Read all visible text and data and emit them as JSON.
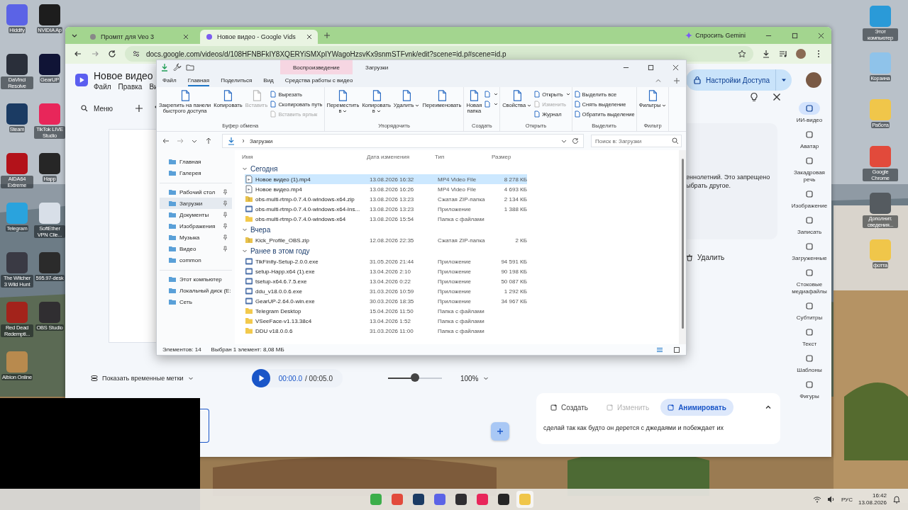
{
  "desktop": {
    "left_icons": [
      {
        "label": "Hiddify",
        "color": "#5b63e6"
      },
      {
        "label": "NVIDIA Ap",
        "color": "#1d1d1d"
      },
      {
        "label": "DaVinci Resolve",
        "color": "#2a2f3a"
      },
      {
        "label": "GearUP",
        "color": "#101436"
      },
      {
        "label": "Steam",
        "color": "#1b3b63"
      },
      {
        "label": "TikTok LIVE Studio",
        "color": "#e8265a"
      },
      {
        "label": "AIDA64 Extreme",
        "color": "#b3121a"
      },
      {
        "label": "Happ",
        "color": "#262626"
      },
      {
        "label": "Telegram",
        "color": "#2aa3dd"
      },
      {
        "label": "SoftEther VPN Clie...",
        "color": "#d8dfe8"
      },
      {
        "label": "The Witcher 3 Wild Hunt",
        "color": "#3a3a44"
      },
      {
        "label": "595.97-desk",
        "color": "#2b2b2b"
      },
      {
        "label": "Red Dead Redempti...",
        "color": "#a3231b"
      },
      {
        "label": "OBS Studio",
        "color": "#302e31"
      },
      {
        "label": "Albion Online",
        "color": "#b88a4e"
      }
    ],
    "right_icons": [
      {
        "label": "Этот компьютер",
        "color": "#2a9ad8"
      },
      {
        "label": "Корзина",
        "color": "#8fc3ea"
      },
      {
        "label": "Работа",
        "color": "#f0c64a"
      },
      {
        "label": "Google Chrome",
        "color": "#e24a3b"
      },
      {
        "label": "Дополнит. сведения...",
        "color": "#555b60"
      },
      {
        "label": "фотта",
        "color": "#f0c64a"
      }
    ]
  },
  "browser": {
    "tabs": [
      {
        "title": "Промпт для Veo 3",
        "selected": false
      },
      {
        "title": "Новое видео - Google Vids",
        "selected": true
      }
    ],
    "gemini": "Спросить Gemini",
    "url": "docs.google.com/videos/d/108HFNBFkIY8XQERYiSMXpIYWagoHzsvKx9snmSTFvnk/edit?scene=id.p#scene=id.p",
    "doc_title": "Новое видео",
    "menus": [
      "Файл",
      "Правка",
      "Ви"
    ],
    "menu_search": "Меню",
    "share_button": "Настройки Доступа",
    "panel_text": [
      "еннолетний. Это запрещено",
      "ыбрать другое."
    ],
    "delete": "Удалить",
    "timestamps": "Показать временные метки",
    "time_current": "00:00.0",
    "time_total": "/ 00:05.0",
    "volume": {
      "level": 0.5
    },
    "zoom": "100%",
    "prompt": {
      "tabs": [
        {
          "label": "Создать",
          "selected": false,
          "disabled": false
        },
        {
          "label": "Изменить",
          "selected": false,
          "disabled": true
        },
        {
          "label": "Анимировать",
          "selected": true,
          "disabled": false
        }
      ],
      "text": "сделай так как будто он дерется с джедаями и побеждает их"
    },
    "rail": [
      {
        "label": "ИИ-видео",
        "selected": true
      },
      {
        "label": "Аватар",
        "selected": false
      },
      {
        "label": "Закадровая речь",
        "selected": false
      },
      {
        "label": "Изображение",
        "selected": false
      },
      {
        "label": "Записать",
        "selected": false
      },
      {
        "label": "Загруженные",
        "selected": false
      },
      {
        "label": "Стоковые медиафайлы",
        "selected": false
      },
      {
        "label": "Субтитры",
        "selected": false
      },
      {
        "label": "Текст",
        "selected": false
      },
      {
        "label": "Шаблоны",
        "selected": false
      },
      {
        "label": "Фигуры",
        "selected": false
      }
    ]
  },
  "explorer": {
    "tabs": [
      {
        "label": "Воспроизведение",
        "selected": true
      },
      {
        "label": "Загрузки",
        "selected": false
      }
    ],
    "menu": [
      {
        "label": "Файл",
        "selected": false
      },
      {
        "label": "Главная",
        "selected": true
      },
      {
        "label": "Поделиться",
        "selected": false
      },
      {
        "label": "Вид",
        "selected": false
      },
      {
        "label": "Средства работы с видео",
        "selected": false
      }
    ],
    "ribbon": [
      {
        "label": "Буфер обмена",
        "large": [
          {
            "label": "Закрепить на панели\nбыстрого доступа",
            "disabled": false,
            "menu": false
          },
          {
            "label": "Копировать",
            "disabled": false,
            "menu": false
          },
          {
            "label": "Вставить",
            "disabled": true,
            "menu": false
          }
        ],
        "small": [
          {
            "label": "Вырезать",
            "disabled": false,
            "menu": false
          },
          {
            "label": "Скопировать путь",
            "disabled": false,
            "menu": false
          },
          {
            "label": "Вставить ярлык",
            "disabled": true,
            "menu": false
          }
        ]
      },
      {
        "label": "Упорядочить",
        "large": [
          {
            "label": "Переместить\nв",
            "disabled": false,
            "menu": true
          },
          {
            "label": "Копировать\nв",
            "disabled": false,
            "menu": true
          },
          {
            "label": "Удалить",
            "disabled": false,
            "menu": true
          },
          {
            "label": "Переименовать",
            "disabled": false,
            "menu": false
          }
        ]
      },
      {
        "label": "Создать",
        "large": [
          {
            "label": "Новая\nпапка",
            "disabled": false,
            "menu": false
          }
        ],
        "small": [
          {
            "disabled": false,
            "menu": true
          },
          {
            "disabled": false,
            "menu": true
          }
        ]
      },
      {
        "label": "Открыть",
        "large": [
          {
            "label": "Свойства",
            "disabled": false,
            "menu": true
          }
        ],
        "small": [
          {
            "label": "Открыть",
            "disabled": false,
            "menu": true
          },
          {
            "label": "Изменить",
            "disabled": true,
            "menu": false
          },
          {
            "label": "Журнал",
            "disabled": false,
            "menu": false
          }
        ]
      },
      {
        "label": "Выделить",
        "small": [
          {
            "label": "Выделить все",
            "disabled": false,
            "menu": false
          },
          {
            "label": "Снять выделение",
            "disabled": false,
            "menu": false
          },
          {
            "label": "Обратить выделение",
            "disabled": false,
            "menu": false
          }
        ]
      },
      {
        "label": "Фильтр",
        "large": [
          {
            "label": "Фильтры",
            "disabled": false,
            "menu": true
          }
        ]
      }
    ],
    "path": "Загрузки",
    "search_placeholder": "Поиск в: Загрузки",
    "nav": [
      {
        "items": [
          {
            "label": "Главная",
            "pinned": false,
            "selected": false
          },
          {
            "label": "Галерея",
            "pinned": false,
            "selected": false
          }
        ]
      },
      {
        "items": [
          {
            "label": "Рабочий стол",
            "pinned": true,
            "selected": false
          },
          {
            "label": "Загрузки",
            "pinned": true,
            "selected": true
          },
          {
            "label": "Документы",
            "pinned": true,
            "selected": false
          },
          {
            "label": "Изображения",
            "pinned": true,
            "selected": false
          },
          {
            "label": "Музыка",
            "pinned": true,
            "selected": false
          },
          {
            "label": "Видео",
            "pinned": true,
            "selected": false
          },
          {
            "label": "common",
            "pinned": false,
            "selected": false
          }
        ]
      },
      {
        "items": [
          {
            "label": "Этот компьютер",
            "pinned": false,
            "selected": false
          },
          {
            "label": "Локальный диск (E:",
            "pinned": false,
            "selected": false
          },
          {
            "label": "Сеть",
            "pinned": false,
            "selected": false
          }
        ]
      }
    ],
    "columns": [
      "Имя",
      "Дата изменения",
      "Тип",
      "Размер"
    ],
    "groups": [
      {
        "title": "Сегодня",
        "rows": [
          {
            "kind": "video",
            "name": "Новое видео (1).mp4",
            "date": "13.08.2026 16:32",
            "type": "MP4 Video File",
            "size": "8 278 КБ",
            "selected": true
          },
          {
            "kind": "video",
            "name": "Новое видео.mp4",
            "date": "13.08.2026 16:26",
            "type": "MP4 Video File",
            "size": "4 693 КБ",
            "selected": false
          },
          {
            "kind": "zip",
            "name": "obs-multi-rtmp-0.7.4.0-windows-x64.zip",
            "date": "13.08.2026 13:23",
            "type": "Сжатая ZIP-папка",
            "size": "2 134 КБ",
            "selected": false
          },
          {
            "kind": "app",
            "name": "obs-multi-rtmp-0.7.4.0-windows-x64-Ins...",
            "date": "13.08.2026 13:23",
            "type": "Приложение",
            "size": "1 388 КБ",
            "selected": false
          },
          {
            "kind": "folder",
            "name": "obs-multi-rtmp-0.7.4.0-windows-x64",
            "date": "13.08.2026 15:54",
            "type": "Папка с файлами",
            "selected": false
          }
        ]
      },
      {
        "title": "Вчера",
        "rows": [
          {
            "kind": "zip",
            "name": "Kick_Profile_OBS.zip",
            "date": "12.08.2026 22:35",
            "type": "Сжатая ZIP-папка",
            "size": "2 КБ",
            "selected": false
          }
        ]
      },
      {
        "title": "Ранее в этом году",
        "rows": [
          {
            "kind": "app",
            "name": "TikFinity-Setup-2.0.0.exe",
            "date": "31.05.2026 21:44",
            "type": "Приложение",
            "size": "94 591 КБ",
            "selected": false
          },
          {
            "kind": "app",
            "name": "setup-Happ.x64 (1).exe",
            "date": "13.04.2026 2:10",
            "type": "Приложение",
            "size": "90 198 КБ",
            "selected": false
          },
          {
            "kind": "app",
            "name": "tsetup-x64.6.7.5.exe",
            "date": "13.04.2026 0:22",
            "type": "Приложение",
            "size": "50 087 КБ",
            "selected": false
          },
          {
            "kind": "app",
            "name": "ddu_v18.0.0.6.exe",
            "date": "31.03.2026 10:59",
            "type": "Приложение",
            "size": "1 292 КБ",
            "selected": false
          },
          {
            "kind": "app",
            "name": "GearUP-2.64.0-win.exe",
            "date": "30.03.2026 18:35",
            "type": "Приложение",
            "size": "34 967 КБ",
            "selected": false
          },
          {
            "kind": "folder",
            "name": "Telegram Desktop",
            "date": "15.04.2026 11:50",
            "type": "Папка с файлами",
            "selected": false
          },
          {
            "kind": "folder",
            "name": "VSeeFace-v1.13.38c4",
            "date": "13.04.2026 1:52",
            "type": "Папка с файлами",
            "selected": false
          },
          {
            "kind": "folder",
            "name": "DDU v18.0.0.6",
            "date": "31.03.2026 11:00",
            "type": "Папка с файлами",
            "selected": false
          }
        ]
      }
    ],
    "status_count": "Элементов: 14",
    "status_selection": "Выбран 1 элемент: 8,08 МБ"
  },
  "taskbar": {
    "apps": [
      {
        "color": "#3cae4a",
        "selected": false
      },
      {
        "color": "#e24a3b",
        "selected": false
      },
      {
        "color": "#1b3b63",
        "selected": false
      },
      {
        "color": "#5b63e6",
        "selected": false
      },
      {
        "color": "#302e31",
        "selected": false
      },
      {
        "color": "#e8265a",
        "selected": false
      },
      {
        "color": "#262626",
        "selected": false
      },
      {
        "color": "#f0c64a",
        "selected": true
      }
    ],
    "lang": "РУС",
    "time": "16:42",
    "date": "13.08.2026"
  }
}
